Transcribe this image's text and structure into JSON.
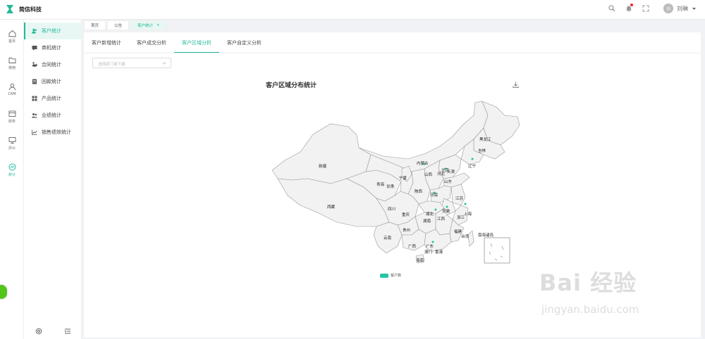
{
  "app": {
    "name": "简信科技"
  },
  "header": {
    "user_avatar": "刘",
    "user_name": "刘琳"
  },
  "rail": [
    {
      "label": "首页"
    },
    {
      "label": "常用"
    },
    {
      "label": "CRM"
    },
    {
      "label": "财务"
    },
    {
      "label": "办公"
    },
    {
      "label": "统计"
    }
  ],
  "menu": [
    {
      "label": "客户统计"
    },
    {
      "label": "商机统计"
    },
    {
      "label": "合同统计"
    },
    {
      "label": "回款统计"
    },
    {
      "label": "产品统计"
    },
    {
      "label": "业绩统计"
    },
    {
      "label": "销售绩效统计"
    }
  ],
  "tabs": [
    {
      "label": "首页"
    },
    {
      "label": "公告"
    },
    {
      "label": "客户统计",
      "close": "×"
    }
  ],
  "subtabs": [
    "客户新增统计",
    "客户成交分析",
    "客户区域分析",
    "客户自定义分析"
  ],
  "filter": {
    "placeholder": "选择部门或下属"
  },
  "chart_data": {
    "type": "map",
    "title": "客户区域分布统计",
    "legend": [
      {
        "name": "客户数",
        "color": "#24c5a5"
      }
    ],
    "regions": [
      "新疆",
      "西藏",
      "青海",
      "甘肃",
      "宁夏",
      "内蒙古",
      "黑龙江",
      "吉林",
      "辽宁",
      "河北",
      "北京",
      "天津",
      "山西",
      "陕西",
      "河南",
      "山东",
      "四川",
      "重庆",
      "湖北",
      "安徽",
      "江苏",
      "上海",
      "浙江",
      "湖南",
      "江西",
      "贵州",
      "云南",
      "广西",
      "广东",
      "福建",
      "台湾",
      "香港",
      "澳门",
      "海南",
      "南海诸岛"
    ]
  },
  "watermark": {
    "big": "Bai 经验",
    "small": "jingyan.baidu.com"
  }
}
